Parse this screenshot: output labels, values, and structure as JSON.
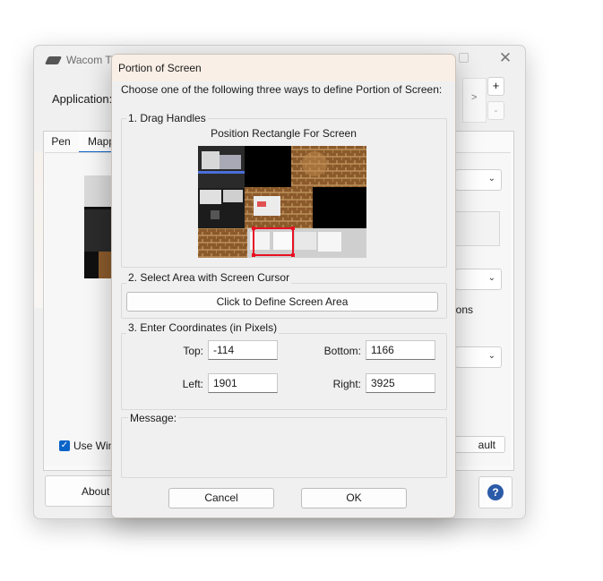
{
  "background_window": {
    "title": "Wacom Tab",
    "application_label": "Application:",
    "chevron": ">",
    "plus": "+",
    "minus": "-",
    "tabs": [
      "Pen",
      "Mapp"
    ],
    "ions_text": "ions",
    "use_win_label": "Use Win",
    "default_button_label": "ault",
    "about_button_label": "About",
    "help_icon": "?",
    "close_icon": "✕",
    "dropdown_chevron": "⌄"
  },
  "dialog": {
    "title": "Portion of Screen",
    "intro": "Choose one of the following three ways to define Portion of Screen:",
    "group1": {
      "label": "1. Drag Handles",
      "caption": "Position Rectangle For Screen"
    },
    "group2": {
      "label": "2. Select Area with Screen Cursor",
      "button_label": "Click to Define Screen Area"
    },
    "group3": {
      "label": "3. Enter Coordinates (in Pixels)",
      "top_label": "Top:",
      "top_value": "-114",
      "bottom_label": "Bottom:",
      "bottom_value": "1166",
      "left_label": "Left:",
      "left_value": "1901",
      "right_label": "Right:",
      "right_value": "3925"
    },
    "message_group": {
      "label": "Message:"
    },
    "cancel_label": "Cancel",
    "ok_label": "OK"
  },
  "colors": {
    "accent": "#0a64c8",
    "selection_rect": "#e81123",
    "dialog_titlebar": "#f9efe6"
  }
}
